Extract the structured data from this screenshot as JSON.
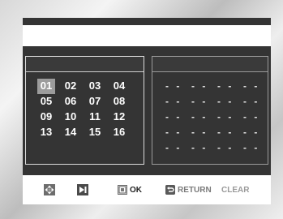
{
  "tracks": [
    "01",
    "02",
    "03",
    "04",
    "05",
    "06",
    "07",
    "08",
    "09",
    "10",
    "11",
    "12",
    "13",
    "14",
    "15",
    "16"
  ],
  "selected_track": "01",
  "program_slots": [
    "- -",
    "- -",
    "- -",
    "- -",
    "- -",
    "- -",
    "- -",
    "- -",
    "- -",
    "- -",
    "- -",
    "- -",
    "- -",
    "- -",
    "- -",
    "- -",
    "- -",
    "- -",
    "- -",
    "- -"
  ],
  "footer": {
    "ok_label": "OK",
    "return_label": "RETURN",
    "clear_label": "CLEAR"
  },
  "icons": {
    "navigate": "navigate-icon",
    "play": "play-skip-icon",
    "enter": "enter-icon",
    "return": "return-icon"
  },
  "colors": {
    "screen": "#343434",
    "bar": "#ffffff",
    "selected": "#9c9c9c"
  }
}
